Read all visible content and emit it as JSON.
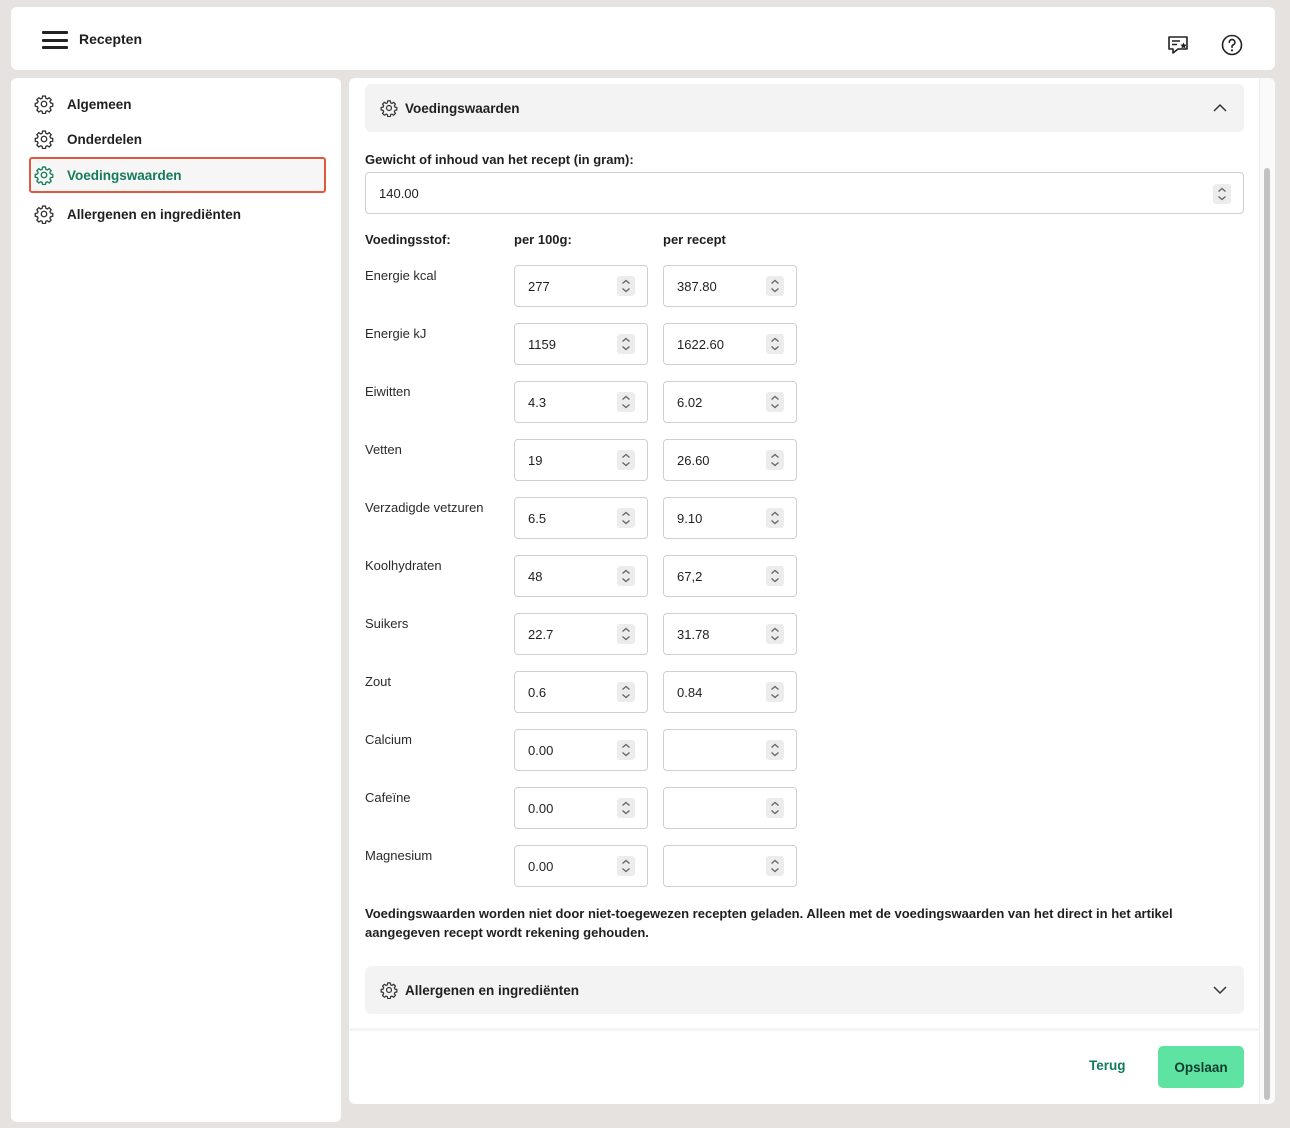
{
  "header": {
    "title": "Recepten",
    "feedback_icon": "feedback-star-icon",
    "help_icon": "help-circle-icon"
  },
  "sidebar": {
    "items": [
      {
        "label": "Algemeen",
        "icon": "gear-icon"
      },
      {
        "label": "Onderdelen",
        "icon": "gear-icon"
      },
      {
        "label": "Voedingswaarden",
        "icon": "gear-icon",
        "active": true
      },
      {
        "label": "Allergenen en ingrediënten",
        "icon": "gear-icon"
      }
    ]
  },
  "main": {
    "section_nutrition": {
      "title": "Voedingswaarden",
      "expanded": true
    },
    "weight": {
      "label": "Gewicht of inhoud van het recept (in gram):",
      "value": "140.00"
    },
    "columns": {
      "nutrient": "Voedingsstof:",
      "per100": "per 100g:",
      "perRecipe": "per recept"
    },
    "rows": [
      {
        "label": "Energie kcal",
        "per100": "277",
        "perRecipe": "387.80"
      },
      {
        "label": "Energie kJ",
        "per100": "1159",
        "perRecipe": "1622.60"
      },
      {
        "label": "Eiwitten",
        "per100": "4.3",
        "perRecipe": "6.02"
      },
      {
        "label": "Vetten",
        "per100": "19",
        "perRecipe": "26.60"
      },
      {
        "label": "Verzadigde vetzuren",
        "per100": "6.5",
        "perRecipe": "9.10"
      },
      {
        "label": "Koolhydraten",
        "per100": "48",
        "perRecipe": "67,2"
      },
      {
        "label": "Suikers",
        "per100": "22.7",
        "perRecipe": "31.78"
      },
      {
        "label": "Zout",
        "per100": "0.6",
        "perRecipe": "0.84"
      },
      {
        "label": "Calcium",
        "per100": "0.00",
        "perRecipe": ""
      },
      {
        "label": "Cafeïne",
        "per100": "0.00",
        "perRecipe": ""
      },
      {
        "label": "Magnesium",
        "per100": "0.00",
        "perRecipe": ""
      }
    ],
    "note": "Voedingswaarden worden niet door niet-toegewezen recepten geladen. Alleen met de voedingswaarden van het direct in het artikel aangegeven recept wordt rekening gehouden.",
    "section_allergens": {
      "title": "Allergenen en ingrediënten",
      "expanded": false
    }
  },
  "footer": {
    "back_label": "Terug",
    "save_label": "Opslaan"
  },
  "colors": {
    "accent": "#137b5c",
    "save_button": "#5ee3a3",
    "active_outline": "#e0593f"
  }
}
